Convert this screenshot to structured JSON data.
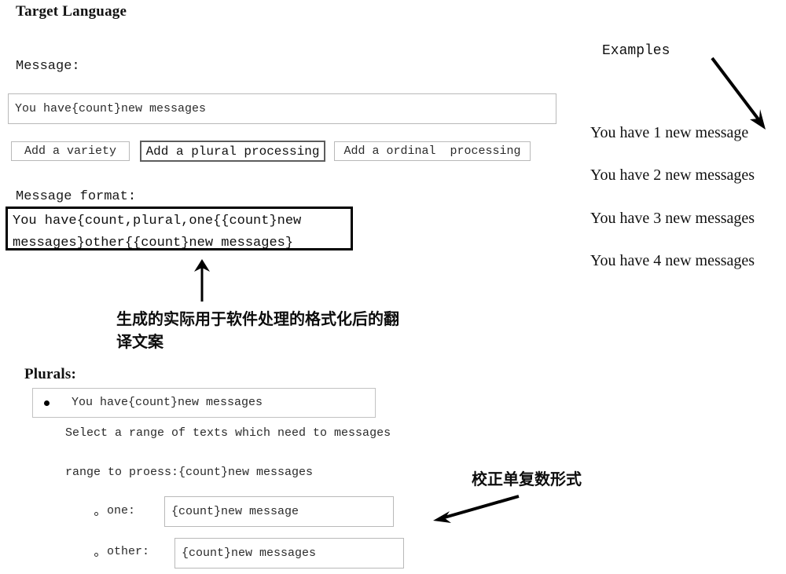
{
  "page": {
    "title": "Target Language"
  },
  "message_section": {
    "label": "Message:",
    "input_value": "You have{count}new messages",
    "input_placeholder": "Enter message"
  },
  "buttons": [
    {
      "name": "add-a-variety-button",
      "label": "Add a variety",
      "emphasized": false
    },
    {
      "name": "add-a-plural-processing-button",
      "label": "Add a plural processing",
      "emphasized": true
    },
    {
      "name": "add-a-ordinal-processing-button",
      "label": "Add a ordinal  processing",
      "emphasized": false
    }
  ],
  "message_format": {
    "label": "Message format:",
    "line1": "You have{count,plural,one{{count}new",
    "line2": "messages}other{{count}new messages}"
  },
  "annotations": {
    "format_note": {
      "line1": "生成的实际用于软件处理的格式化后的翻",
      "line2": "译文案"
    },
    "plural_note": "校正单复数形式"
  },
  "plurals_section": {
    "label": "Plurals:",
    "source_item": "You have{count}new messages",
    "hint_line": "Select a range of texts which need to messages",
    "range_line": "range to proess:{count}new messages",
    "forms": [
      {
        "key": "one:",
        "value": "{count}new message",
        "placeholder": "one form"
      },
      {
        "key": "other:",
        "value": "{count}new messages",
        "placeholder": "other form"
      }
    ]
  },
  "examples": {
    "title": "Examples",
    "items": [
      "You have 1 new message",
      "You have 2 new messages",
      "You have 3 new messages",
      "You have 4 new messages"
    ]
  },
  "colors": {
    "text": "#000000",
    "border": "#b9b9b9",
    "strong_border": "#000000",
    "background": "#ffffff"
  }
}
